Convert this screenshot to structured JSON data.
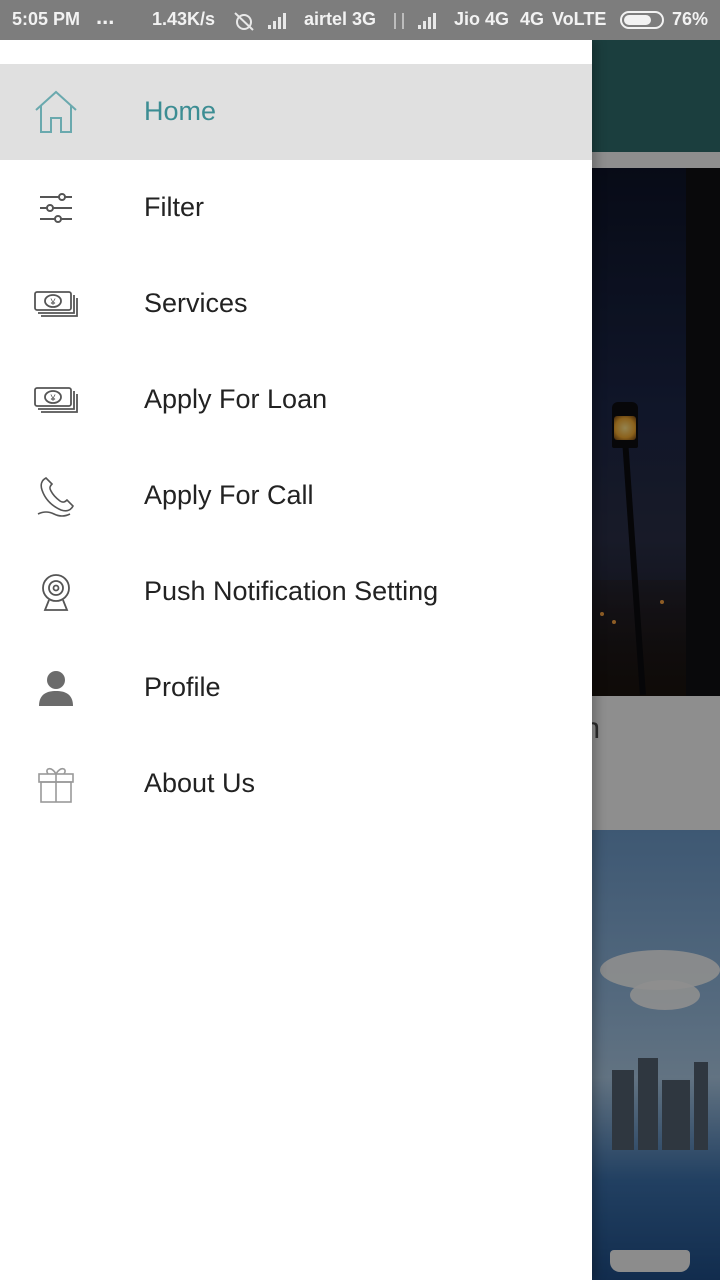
{
  "status_bar": {
    "time": "5:05 PM",
    "dots": "...",
    "speed": "1.43K/s",
    "carrier1": "airtel 3G",
    "carrier2": "Jio 4G",
    "network2": "4G",
    "volte": "VoLTE",
    "battery_text": "76%",
    "battery_level": 0.76
  },
  "drawer": {
    "items": [
      {
        "label": "Home",
        "icon": "home-icon",
        "active": true
      },
      {
        "label": "Filter",
        "icon": "filter-sliders-icon",
        "active": false
      },
      {
        "label": "Services",
        "icon": "money-stack-icon",
        "active": false
      },
      {
        "label": "Apply For Loan",
        "icon": "money-stack-icon",
        "active": false
      },
      {
        "label": "Apply For Call",
        "icon": "phone-icon",
        "active": false
      },
      {
        "label": "Push Notification Setting",
        "icon": "webcam-icon",
        "active": false
      },
      {
        "label": "Profile",
        "icon": "person-icon",
        "active": false
      },
      {
        "label": "About Us",
        "icon": "gift-icon",
        "active": false
      }
    ]
  },
  "background": {
    "card_text": "ian"
  },
  "colors": {
    "accent": "#3c8d93",
    "active_row": "#e0e0e0",
    "toolbar": "#2f6b6c"
  }
}
